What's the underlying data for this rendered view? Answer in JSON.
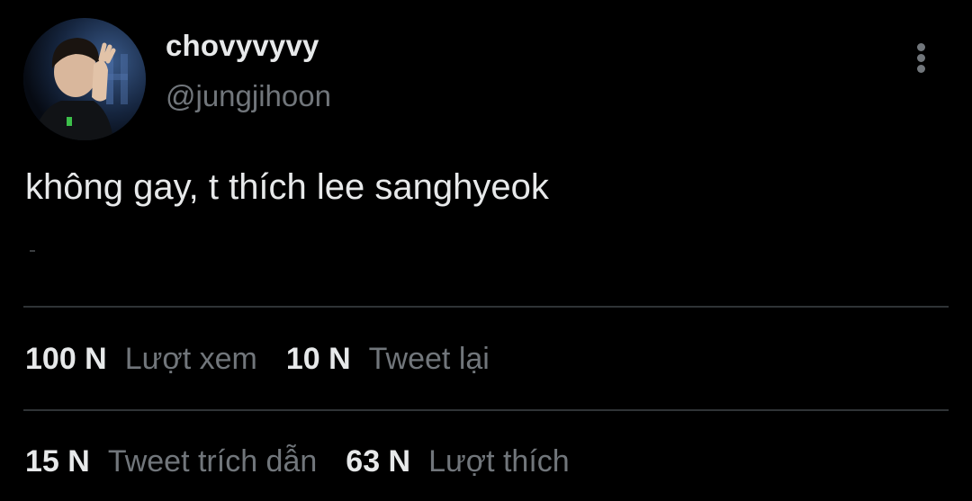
{
  "user": {
    "display_name": "chovyvyvy",
    "handle": "@jungjihoon"
  },
  "icons": {
    "more": "more-vertical-icon",
    "avatar": "avatar-image"
  },
  "tweet": {
    "text": "không gay, t thích lee sanghyeok"
  },
  "stats": {
    "row1": [
      {
        "count": "100 N",
        "label": "Lượt xem"
      },
      {
        "count": "10 N",
        "label": "Tweet lại"
      }
    ],
    "row2": [
      {
        "count": "15 N",
        "label": "Tweet trích dẫn"
      },
      {
        "count": "63 N",
        "label": "Lượt thích"
      }
    ]
  },
  "colors": {
    "background": "#000000",
    "primary_text": "#e7e9ea",
    "secondary_text": "#71767b",
    "divider": "#2f3336"
  }
}
